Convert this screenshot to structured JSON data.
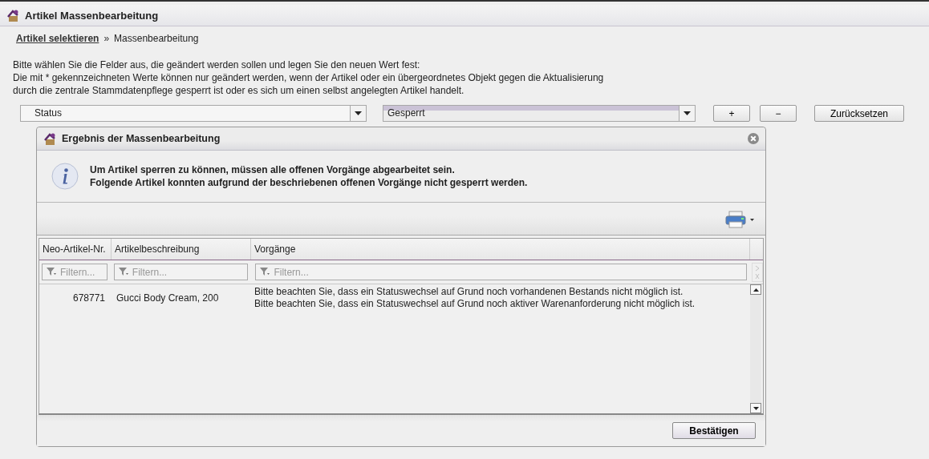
{
  "window": {
    "title": "Artikel Massenbearbeitung"
  },
  "breadcrumb": {
    "link": "Artikel selektieren",
    "separator": "»",
    "current": "Massenbearbeitung"
  },
  "instructions": [
    "Bitte wählen Sie die Felder aus, die geändert werden sollen und legen Sie den neuen Wert fest:",
    "Die mit * gekennzeichneten Werte können nur geändert werden, wenn der Artikel oder ein übergeordnetes Objekt gegen die Aktualisierung",
    "durch die zentrale Stammdatenpflege gesperrt ist oder es sich um einen selbst angelegten Artikel handelt."
  ],
  "field_select": {
    "value": "Status"
  },
  "value_select": {
    "value": "Gesperrt"
  },
  "buttons": [
    "+",
    "−",
    "Zurücksetzen"
  ],
  "dialog": {
    "title": "Ergebnis der Massenbearbeitung",
    "message": [
      "Um Artikel sperren zu können, müssen alle offenen Vorgänge abgearbeitet sein.",
      "Folgende Artikel konnten aufgrund der beschriebenen offenen Vorgänge nicht gesperrt werden."
    ],
    "table": {
      "columns": [
        {
          "label": "Neo-Artikel-Nr.",
          "filter_placeholder": "Filtern..."
        },
        {
          "label": "Artikelbeschreibung",
          "filter_placeholder": "Filtern..."
        },
        {
          "label": "Vorgänge",
          "filter_placeholder": "Filtern..."
        }
      ],
      "rows": [
        {
          "number": "678771",
          "description": "Gucci Body Cream, 200",
          "processes": [
            "Bitte beachten Sie, dass ein Statuswechsel auf Grund noch vorhandenen Bestands nicht möglich ist.",
            "Bitte beachten Sie, dass ein Statuswechsel auf Grund noch aktiver Warenanforderung nicht möglich ist."
          ]
        }
      ]
    },
    "confirm_button": "Bestätigen"
  }
}
